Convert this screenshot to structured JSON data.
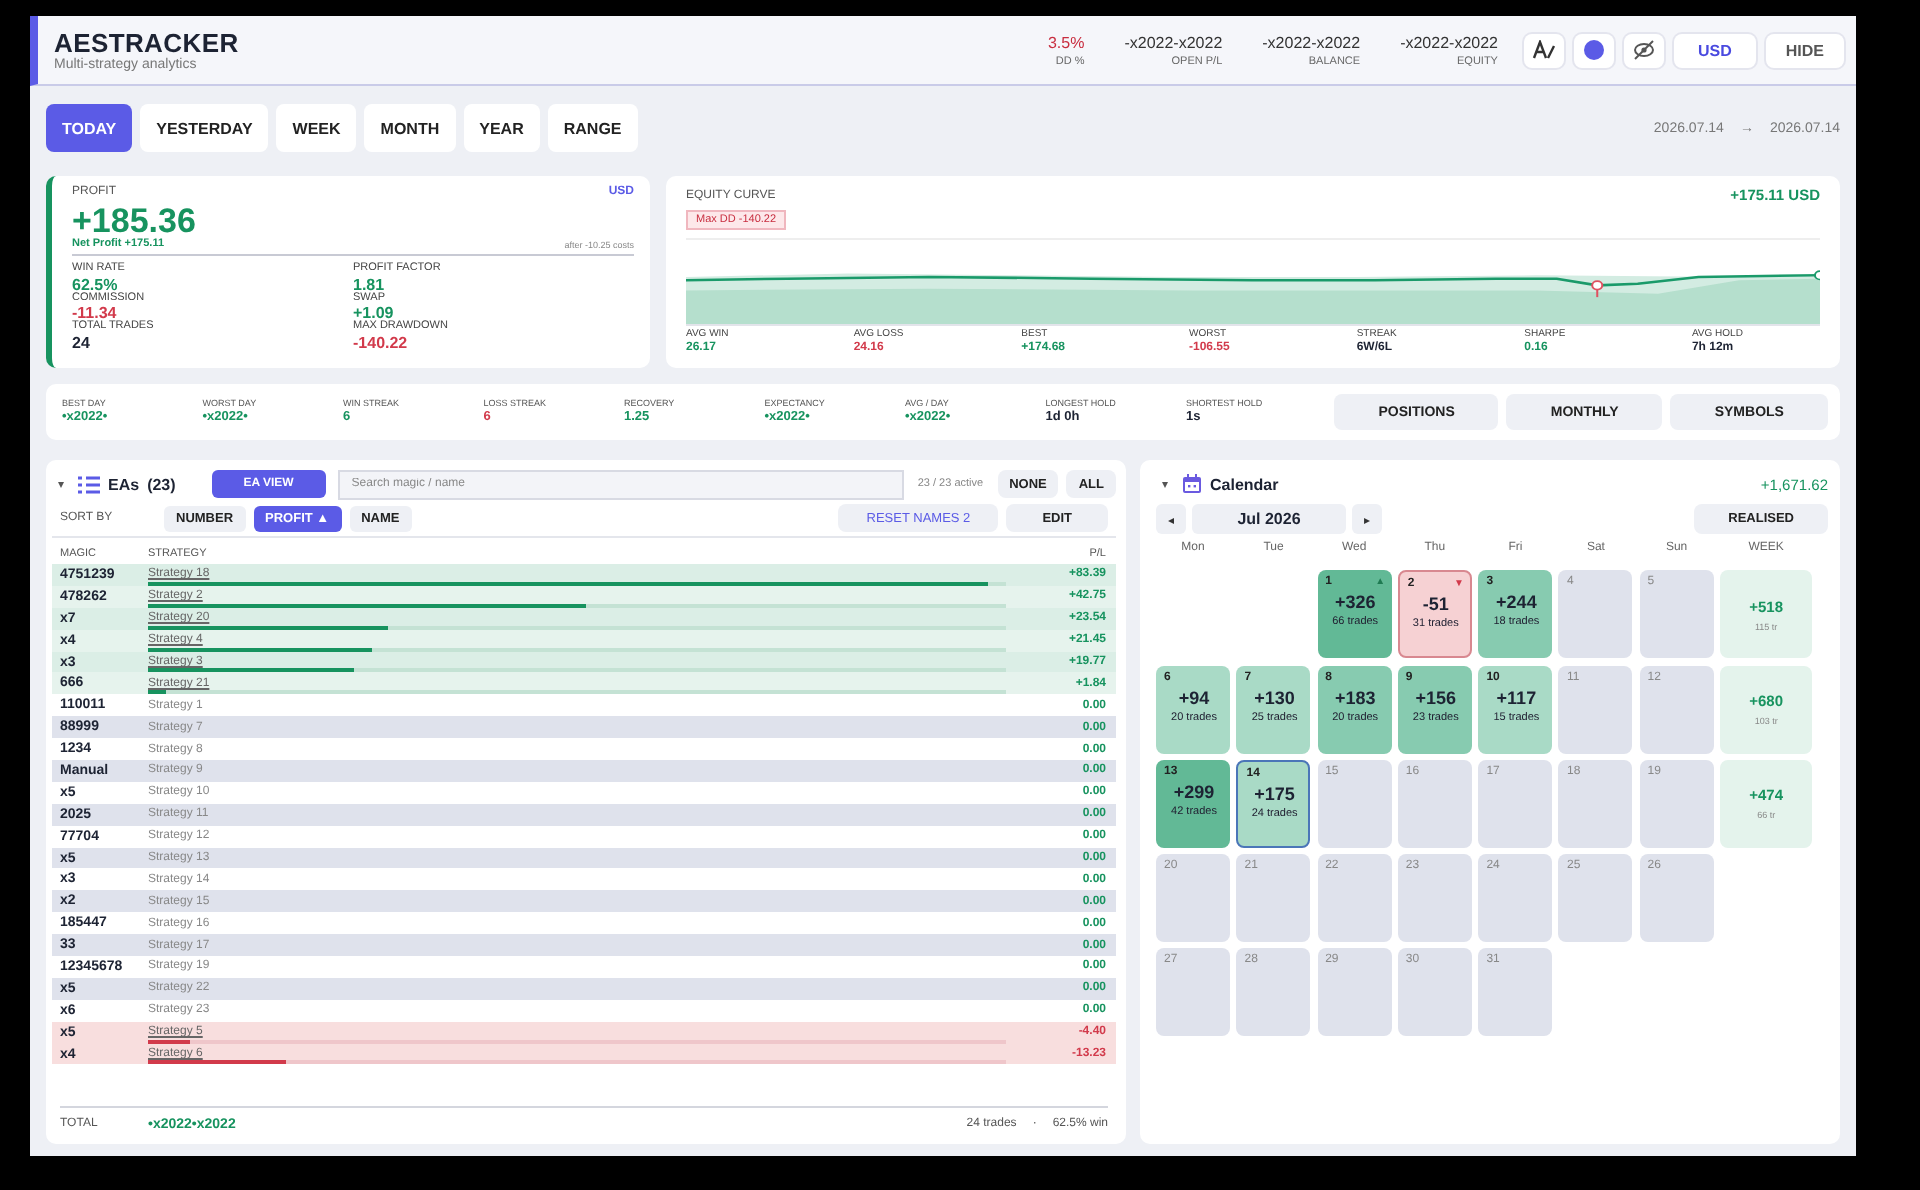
{
  "header": {
    "title": "AESTRACKER",
    "subtitle": "Multi-strategy analytics",
    "stats": [
      {
        "value": "3.5%",
        "label": "DD %",
        "color": "#c82d3f"
      },
      {
        "value": "-x2022-x2022",
        "label": "OPEN P/L",
        "color": "#333333"
      },
      {
        "value": "-x2022-x2022",
        "label": "BALANCE",
        "color": "#333333"
      },
      {
        "value": "-x2022-x2022",
        "label": "EQUITY",
        "color": "#333333"
      }
    ],
    "currency": "USD",
    "hide": "HIDE"
  },
  "periods": [
    {
      "label": "TODAY",
      "selected": true
    },
    {
      "label": "YESTERDAY",
      "selected": false
    },
    {
      "label": "WEEK",
      "selected": false
    },
    {
      "label": "MONTH",
      "selected": false
    },
    {
      "label": "YEAR",
      "selected": false
    },
    {
      "label": "RANGE",
      "selected": false
    }
  ],
  "date_range": {
    "from": "2026.07.14",
    "arrow": "→",
    "to": "2026.07.14"
  },
  "profit": {
    "label": "PROFIT",
    "currency": "USD",
    "value": "+185.36",
    "net": "Net Profit +175.11",
    "note": "after -10.25 costs",
    "metrics": [
      {
        "label": "WIN RATE",
        "value": "62.5%",
        "color": "#17935f"
      },
      {
        "label": "PROFIT FACTOR",
        "value": "1.81",
        "color": "#17935f"
      },
      {
        "label": "COMMISSION",
        "value": "-11.34",
        "color": "#d23a4b"
      },
      {
        "label": "SWAP",
        "value": "+1.09",
        "color": "#17935f"
      },
      {
        "label": "TOTAL TRADES",
        "value": "24",
        "color": "#1d2333"
      },
      {
        "label": "MAX DRAWDOWN",
        "value": "-140.22",
        "color": "#d23a4b"
      }
    ]
  },
  "equity": {
    "label": "EQUITY CURVE",
    "total": "+175.11 USD",
    "max_dd": "Max DD  -140.22",
    "stats": [
      {
        "label": "AVG WIN",
        "value": "26.17",
        "color": "#17935f"
      },
      {
        "label": "AVG LOSS",
        "value": "24.16",
        "color": "#d23a4b"
      },
      {
        "label": "BEST",
        "value": "+174.68",
        "color": "#17935f"
      },
      {
        "label": "WORST",
        "value": "-106.55",
        "color": "#d23a4b"
      },
      {
        "label": "STREAK",
        "value": "6W/6L",
        "color": "#1d2333"
      },
      {
        "label": "SHARPE",
        "value": "0.16",
        "color": "#17935f"
      },
      {
        "label": "AVG HOLD",
        "value": "7h 12m",
        "color": "#1d2333"
      }
    ]
  },
  "summary": {
    "stats": [
      {
        "label": "BEST DAY",
        "value": "•x2022•",
        "color": "#17935f"
      },
      {
        "label": "WORST DAY",
        "value": "•x2022•",
        "color": "#17935f"
      },
      {
        "label": "WIN STREAK",
        "value": "6",
        "color": "#17935f"
      },
      {
        "label": "LOSS STREAK",
        "value": "6",
        "color": "#d23a4b"
      },
      {
        "label": "RECOVERY",
        "value": "1.25",
        "color": "#17935f"
      },
      {
        "label": "EXPECTANCY",
        "value": "•x2022•",
        "color": "#17935f"
      },
      {
        "label": "AVG / DAY",
        "value": "•x2022•",
        "color": "#17935f"
      },
      {
        "label": "LONGEST HOLD",
        "value": "1d 0h",
        "color": "#1d2333"
      },
      {
        "label": "SHORTEST HOLD",
        "value": "1s",
        "color": "#1d2333"
      }
    ],
    "buttons": [
      "POSITIONS",
      "MONTHLY",
      "SYMBOLS"
    ]
  },
  "eas": {
    "caret": "▾",
    "title": "EAs",
    "count": "(23)",
    "view_button": "EA VIEW",
    "search": {
      "placeholder": "Search magic / name"
    },
    "active": "23 / 23 active",
    "none": "NONE",
    "all": "ALL",
    "sort_label": "SORT BY",
    "sorts": [
      {
        "label": "NUMBER",
        "selected": false
      },
      {
        "label": "PROFIT ▲",
        "selected": true
      },
      {
        "label": "NAME",
        "selected": false
      }
    ],
    "reset": "RESET NAMES 2",
    "edit": "EDIT",
    "columns": [
      "MAGIC",
      "STRATEGY",
      "P/L"
    ],
    "rows": [
      {
        "magic": "4751239",
        "strategy": "Strategy 18",
        "pl": "+83.39",
        "kind": "gain",
        "level": 0.98
      },
      {
        "magic": "478262",
        "strategy": "Strategy 2",
        "pl": "+42.75",
        "kind": "gain",
        "level": 0.51
      },
      {
        "magic": "x7",
        "strategy": "Strategy 20",
        "pl": "+23.54",
        "kind": "gain",
        "level": 0.28
      },
      {
        "magic": "x4",
        "strategy": "Strategy 4",
        "pl": "+21.45",
        "kind": "gain",
        "level": 0.26
      },
      {
        "magic": "x3",
        "strategy": "Strategy 3",
        "pl": "+19.77",
        "kind": "gain",
        "level": 0.24
      },
      {
        "magic": "666",
        "strategy": "Strategy 21",
        "pl": "+1.84",
        "kind": "gain",
        "level": 0.02
      },
      {
        "magic": "110011",
        "strategy": "Strategy 1",
        "pl": "0.00",
        "kind": "flat"
      },
      {
        "magic": "88999",
        "strategy": "Strategy 7",
        "pl": "0.00",
        "kind": "flat"
      },
      {
        "magic": "1234",
        "strategy": "Strategy 8",
        "pl": "0.00",
        "kind": "flat"
      },
      {
        "magic": "Manual",
        "strategy": "Strategy 9",
        "pl": "0.00",
        "kind": "flat"
      },
      {
        "magic": "x5",
        "strategy": "Strategy 10",
        "pl": "0.00",
        "kind": "flat"
      },
      {
        "magic": "2025",
        "strategy": "Strategy 11",
        "pl": "0.00",
        "kind": "flat"
      },
      {
        "magic": "77704",
        "strategy": "Strategy 12",
        "pl": "0.00",
        "kind": "flat"
      },
      {
        "magic": "x5",
        "strategy": "Strategy 13",
        "pl": "0.00",
        "kind": "flat"
      },
      {
        "magic": "x3",
        "strategy": "Strategy 14",
        "pl": "0.00",
        "kind": "flat"
      },
      {
        "magic": "x2",
        "strategy": "Strategy 15",
        "pl": "0.00",
        "kind": "flat"
      },
      {
        "magic": "185447",
        "strategy": "Strategy 16",
        "pl": "0.00",
        "kind": "flat"
      },
      {
        "magic": "33",
        "strategy": "Strategy 17",
        "pl": "0.00",
        "kind": "flat"
      },
      {
        "magic": "12345678",
        "strategy": "Strategy 19",
        "pl": "0.00",
        "kind": "flat"
      },
      {
        "magic": "x5",
        "strategy": "Strategy 22",
        "pl": "0.00",
        "kind": "flat"
      },
      {
        "magic": "x6",
        "strategy": "Strategy 23",
        "pl": "0.00",
        "kind": "flat"
      },
      {
        "magic": "x5",
        "strategy": "Strategy 5",
        "pl": "-4.40",
        "kind": "loss",
        "level": 0.05
      },
      {
        "magic": "x4",
        "strategy": "Strategy 6",
        "pl": "-13.23",
        "kind": "loss",
        "level": 0.16
      }
    ],
    "total": {
      "label": "TOTAL",
      "value": "•x2022•x2022",
      "trades": "24 trades",
      "sep": "·",
      "win": "62.5% win"
    }
  },
  "calendar": {
    "caret": "▾",
    "title": "Calendar",
    "total": "+1,671.62",
    "prev": "◂",
    "month": "Jul 2026",
    "next": "▸",
    "mode": "REALISED",
    "weekdays": [
      "Mon",
      "Tue",
      "Wed",
      "Thu",
      "Fri",
      "Sat",
      "Sun"
    ],
    "week_label": "WEEK",
    "weeks": [
      {
        "days": [
          {
            "day": "1",
            "pl": "+326",
            "trades": "66 trades",
            "kind": "strong",
            "marker": "▲",
            "selected": false
          },
          {
            "day": "2",
            "pl": "-51",
            "trades": "31 trades",
            "kind": "loss",
            "marker": "▼",
            "selected": false
          },
          {
            "day": "3",
            "pl": "+244",
            "trades": "18 trades",
            "kind": "medium",
            "selected": false
          },
          {
            "day": "4",
            "kind": "empty",
            "selected": false
          },
          {
            "day": "5",
            "kind": "empty",
            "selected": false
          }
        ],
        "summary": {
          "pl": "+518",
          "trades": "115 tr"
        }
      },
      {
        "days": [
          {
            "day": "6",
            "pl": "+94",
            "trades": "20 trades",
            "kind": "light",
            "selected": false
          },
          {
            "day": "7",
            "pl": "+130",
            "trades": "25 trades",
            "kind": "light",
            "selected": false
          },
          {
            "day": "8",
            "pl": "+183",
            "trades": "20 trades",
            "kind": "medium",
            "selected": false
          },
          {
            "day": "9",
            "pl": "+156",
            "trades": "23 trades",
            "kind": "medium",
            "selected": false
          },
          {
            "day": "10",
            "pl": "+117",
            "trades": "15 trades",
            "kind": "light",
            "selected": false
          },
          {
            "day": "11",
            "kind": "empty",
            "selected": false
          },
          {
            "day": "12",
            "kind": "empty",
            "selected": false
          }
        ],
        "summary": {
          "pl": "+680",
          "trades": "103 tr"
        }
      },
      {
        "days": [
          {
            "day": "13",
            "pl": "+299",
            "trades": "42 trades",
            "kind": "strong",
            "selected": false
          },
          {
            "day": "14",
            "pl": "+175",
            "trades": "24 trades",
            "kind": "light",
            "selected": true
          },
          {
            "day": "15",
            "kind": "empty",
            "selected": false
          },
          {
            "day": "16",
            "kind": "empty",
            "selected": false
          },
          {
            "day": "17",
            "kind": "empty",
            "selected": false
          },
          {
            "day": "18",
            "kind": "empty",
            "selected": false
          },
          {
            "day": "19",
            "kind": "empty",
            "selected": false
          }
        ],
        "summary": {
          "pl": "+474",
          "trades": "66 tr"
        }
      },
      {
        "days": [
          {
            "day": "20",
            "kind": "empty",
            "selected": false
          },
          {
            "day": "21",
            "kind": "empty",
            "selected": false
          },
          {
            "day": "22",
            "kind": "empty",
            "selected": false
          },
          {
            "day": "23",
            "kind": "empty",
            "selected": false
          },
          {
            "day": "24",
            "kind": "empty",
            "selected": false
          },
          {
            "day": "25",
            "kind": "empty",
            "selected": false
          },
          {
            "day": "26",
            "kind": "empty",
            "selected": false
          }
        ]
      },
      {
        "days": [
          {
            "day": "27",
            "kind": "empty",
            "selected": false
          },
          {
            "day": "28",
            "kind": "empty",
            "selected": false
          },
          {
            "day": "29",
            "kind": "empty",
            "selected": false
          },
          {
            "day": "30",
            "kind": "empty",
            "selected": false
          },
          {
            "day": "31",
            "kind": "empty",
            "selected": false
          }
        ]
      }
    ]
  }
}
